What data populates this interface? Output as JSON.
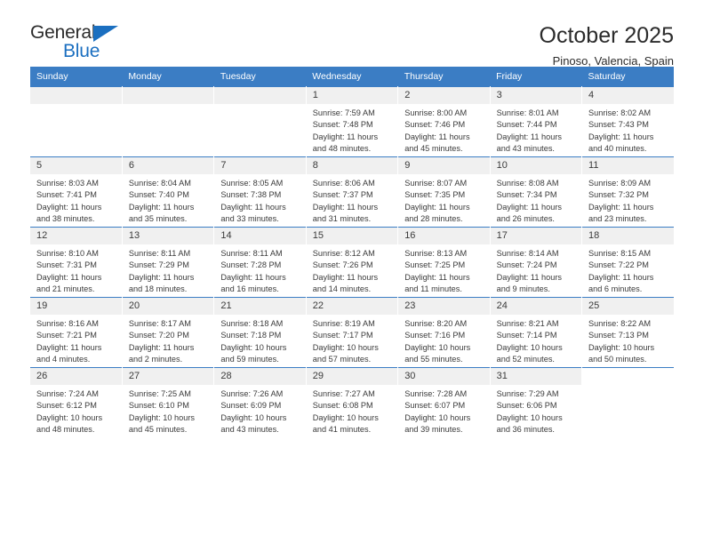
{
  "brand": {
    "word_one": "General",
    "word_two": "Blue",
    "accent_color": "#1b6fc0"
  },
  "header": {
    "title": "October 2025",
    "subtitle": "Pinoso, Valencia, Spain"
  },
  "calendar": {
    "header_bg": "#3b7dc4",
    "daynum_bg": "#f0f0f0",
    "weekday_names": [
      "Sunday",
      "Monday",
      "Tuesday",
      "Wednesday",
      "Thursday",
      "Friday",
      "Saturday"
    ],
    "weeks": [
      [
        {
          "day": "",
          "empty": true,
          "lines": []
        },
        {
          "day": "",
          "empty": true,
          "lines": []
        },
        {
          "day": "",
          "empty": true,
          "lines": []
        },
        {
          "day": "1",
          "lines": [
            "Sunrise: 7:59 AM",
            "Sunset: 7:48 PM",
            "Daylight: 11 hours",
            "and 48 minutes."
          ]
        },
        {
          "day": "2",
          "lines": [
            "Sunrise: 8:00 AM",
            "Sunset: 7:46 PM",
            "Daylight: 11 hours",
            "and 45 minutes."
          ]
        },
        {
          "day": "3",
          "lines": [
            "Sunrise: 8:01 AM",
            "Sunset: 7:44 PM",
            "Daylight: 11 hours",
            "and 43 minutes."
          ]
        },
        {
          "day": "4",
          "lines": [
            "Sunrise: 8:02 AM",
            "Sunset: 7:43 PM",
            "Daylight: 11 hours",
            "and 40 minutes."
          ]
        }
      ],
      [
        {
          "day": "5",
          "lines": [
            "Sunrise: 8:03 AM",
            "Sunset: 7:41 PM",
            "Daylight: 11 hours",
            "and 38 minutes."
          ]
        },
        {
          "day": "6",
          "lines": [
            "Sunrise: 8:04 AM",
            "Sunset: 7:40 PM",
            "Daylight: 11 hours",
            "and 35 minutes."
          ]
        },
        {
          "day": "7",
          "lines": [
            "Sunrise: 8:05 AM",
            "Sunset: 7:38 PM",
            "Daylight: 11 hours",
            "and 33 minutes."
          ]
        },
        {
          "day": "8",
          "lines": [
            "Sunrise: 8:06 AM",
            "Sunset: 7:37 PM",
            "Daylight: 11 hours",
            "and 31 minutes."
          ]
        },
        {
          "day": "9",
          "lines": [
            "Sunrise: 8:07 AM",
            "Sunset: 7:35 PM",
            "Daylight: 11 hours",
            "and 28 minutes."
          ]
        },
        {
          "day": "10",
          "lines": [
            "Sunrise: 8:08 AM",
            "Sunset: 7:34 PM",
            "Daylight: 11 hours",
            "and 26 minutes."
          ]
        },
        {
          "day": "11",
          "lines": [
            "Sunrise: 8:09 AM",
            "Sunset: 7:32 PM",
            "Daylight: 11 hours",
            "and 23 minutes."
          ]
        }
      ],
      [
        {
          "day": "12",
          "lines": [
            "Sunrise: 8:10 AM",
            "Sunset: 7:31 PM",
            "Daylight: 11 hours",
            "and 21 minutes."
          ]
        },
        {
          "day": "13",
          "lines": [
            "Sunrise: 8:11 AM",
            "Sunset: 7:29 PM",
            "Daylight: 11 hours",
            "and 18 minutes."
          ]
        },
        {
          "day": "14",
          "lines": [
            "Sunrise: 8:11 AM",
            "Sunset: 7:28 PM",
            "Daylight: 11 hours",
            "and 16 minutes."
          ]
        },
        {
          "day": "15",
          "lines": [
            "Sunrise: 8:12 AM",
            "Sunset: 7:26 PM",
            "Daylight: 11 hours",
            "and 14 minutes."
          ]
        },
        {
          "day": "16",
          "lines": [
            "Sunrise: 8:13 AM",
            "Sunset: 7:25 PM",
            "Daylight: 11 hours",
            "and 11 minutes."
          ]
        },
        {
          "day": "17",
          "lines": [
            "Sunrise: 8:14 AM",
            "Sunset: 7:24 PM",
            "Daylight: 11 hours",
            "and 9 minutes."
          ]
        },
        {
          "day": "18",
          "lines": [
            "Sunrise: 8:15 AM",
            "Sunset: 7:22 PM",
            "Daylight: 11 hours",
            "and 6 minutes."
          ]
        }
      ],
      [
        {
          "day": "19",
          "lines": [
            "Sunrise: 8:16 AM",
            "Sunset: 7:21 PM",
            "Daylight: 11 hours",
            "and 4 minutes."
          ]
        },
        {
          "day": "20",
          "lines": [
            "Sunrise: 8:17 AM",
            "Sunset: 7:20 PM",
            "Daylight: 11 hours",
            "and 2 minutes."
          ]
        },
        {
          "day": "21",
          "lines": [
            "Sunrise: 8:18 AM",
            "Sunset: 7:18 PM",
            "Daylight: 10 hours",
            "and 59 minutes."
          ]
        },
        {
          "day": "22",
          "lines": [
            "Sunrise: 8:19 AM",
            "Sunset: 7:17 PM",
            "Daylight: 10 hours",
            "and 57 minutes."
          ]
        },
        {
          "day": "23",
          "lines": [
            "Sunrise: 8:20 AM",
            "Sunset: 7:16 PM",
            "Daylight: 10 hours",
            "and 55 minutes."
          ]
        },
        {
          "day": "24",
          "lines": [
            "Sunrise: 8:21 AM",
            "Sunset: 7:14 PM",
            "Daylight: 10 hours",
            "and 52 minutes."
          ]
        },
        {
          "day": "25",
          "lines": [
            "Sunrise: 8:22 AM",
            "Sunset: 7:13 PM",
            "Daylight: 10 hours",
            "and 50 minutes."
          ]
        }
      ],
      [
        {
          "day": "26",
          "lines": [
            "Sunrise: 7:24 AM",
            "Sunset: 6:12 PM",
            "Daylight: 10 hours",
            "and 48 minutes."
          ]
        },
        {
          "day": "27",
          "lines": [
            "Sunrise: 7:25 AM",
            "Sunset: 6:10 PM",
            "Daylight: 10 hours",
            "and 45 minutes."
          ]
        },
        {
          "day": "28",
          "lines": [
            "Sunrise: 7:26 AM",
            "Sunset: 6:09 PM",
            "Daylight: 10 hours",
            "and 43 minutes."
          ]
        },
        {
          "day": "29",
          "lines": [
            "Sunrise: 7:27 AM",
            "Sunset: 6:08 PM",
            "Daylight: 10 hours",
            "and 41 minutes."
          ]
        },
        {
          "day": "30",
          "lines": [
            "Sunrise: 7:28 AM",
            "Sunset: 6:07 PM",
            "Daylight: 10 hours",
            "and 39 minutes."
          ]
        },
        {
          "day": "31",
          "lines": [
            "Sunrise: 7:29 AM",
            "Sunset: 6:06 PM",
            "Daylight: 10 hours",
            "and 36 minutes."
          ]
        },
        {
          "day": "",
          "blank": true,
          "lines": []
        }
      ]
    ]
  }
}
